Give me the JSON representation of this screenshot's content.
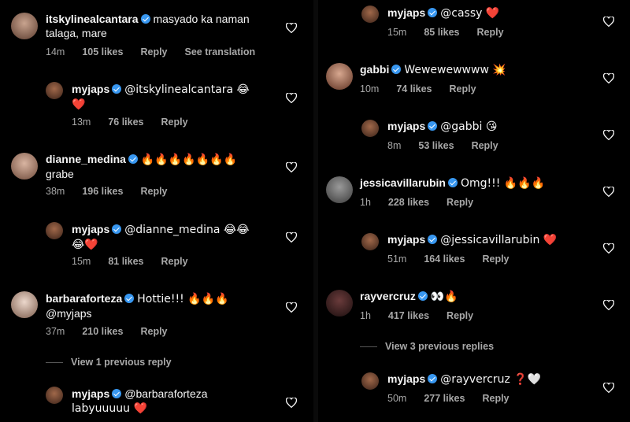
{
  "left": {
    "comments": [
      {
        "user": "itskylinealcantara",
        "text": "masyado ka naman talaga, mare",
        "time": "14m",
        "likes": "105 likes",
        "reply": "Reply",
        "extra": "See translation"
      },
      {
        "user": "myjaps",
        "text": "@itskylinealcantara 😂",
        "text2": "❤️",
        "time": "13m",
        "likes": "76 likes",
        "reply": "Reply"
      },
      {
        "user": "dianne_medina",
        "text": "🔥🔥🔥🔥🔥🔥🔥",
        "text2": "grabe",
        "time": "38m",
        "likes": "196 likes",
        "reply": "Reply"
      },
      {
        "user": "myjaps",
        "text": "@dianne_medina 😂😂",
        "text2": "😂❤️",
        "time": "15m",
        "likes": "81 likes",
        "reply": "Reply"
      },
      {
        "user": "barbaraforteza",
        "text": "Hottie!!! 🔥🔥🔥",
        "text2": "@myjaps",
        "time": "37m",
        "likes": "210 likes",
        "reply": "Reply"
      },
      {
        "user": "myjaps",
        "text": "@barbaraforteza",
        "text2": "labyuuuuu ❤️"
      }
    ],
    "view_replies": "View 1 previous reply"
  },
  "right": {
    "comments": [
      {
        "user": "myjaps",
        "text": "@cassy ❤️",
        "time": "15m",
        "likes": "85 likes",
        "reply": "Reply"
      },
      {
        "user": "gabbi",
        "text": "Wewewewwww 💥",
        "time": "10m",
        "likes": "74 likes",
        "reply": "Reply"
      },
      {
        "user": "myjaps",
        "text": "@gabbi 😘",
        "time": "8m",
        "likes": "53 likes",
        "reply": "Reply"
      },
      {
        "user": "jessicavillarubin",
        "text": "Omg!!! 🔥🔥🔥",
        "time": "1h",
        "likes": "228 likes",
        "reply": "Reply"
      },
      {
        "user": "myjaps",
        "text": "@jessicavillarubin ❤️",
        "time": "51m",
        "likes": "164 likes",
        "reply": "Reply"
      },
      {
        "user": "rayvercruz",
        "text": "👀🔥",
        "time": "1h",
        "likes": "417 likes",
        "reply": "Reply"
      },
      {
        "user": "myjaps",
        "text": "@rayvercruz ❓🤍",
        "time": "50m",
        "likes": "277 likes",
        "reply": "Reply"
      }
    ],
    "view_replies": "View 3 previous replies"
  },
  "colors": {
    "background": "#000000",
    "text": "#f5f5f5",
    "meta": "#a8a8a8",
    "verified": "#3897f0",
    "heart_red": "#ed1c2e"
  }
}
